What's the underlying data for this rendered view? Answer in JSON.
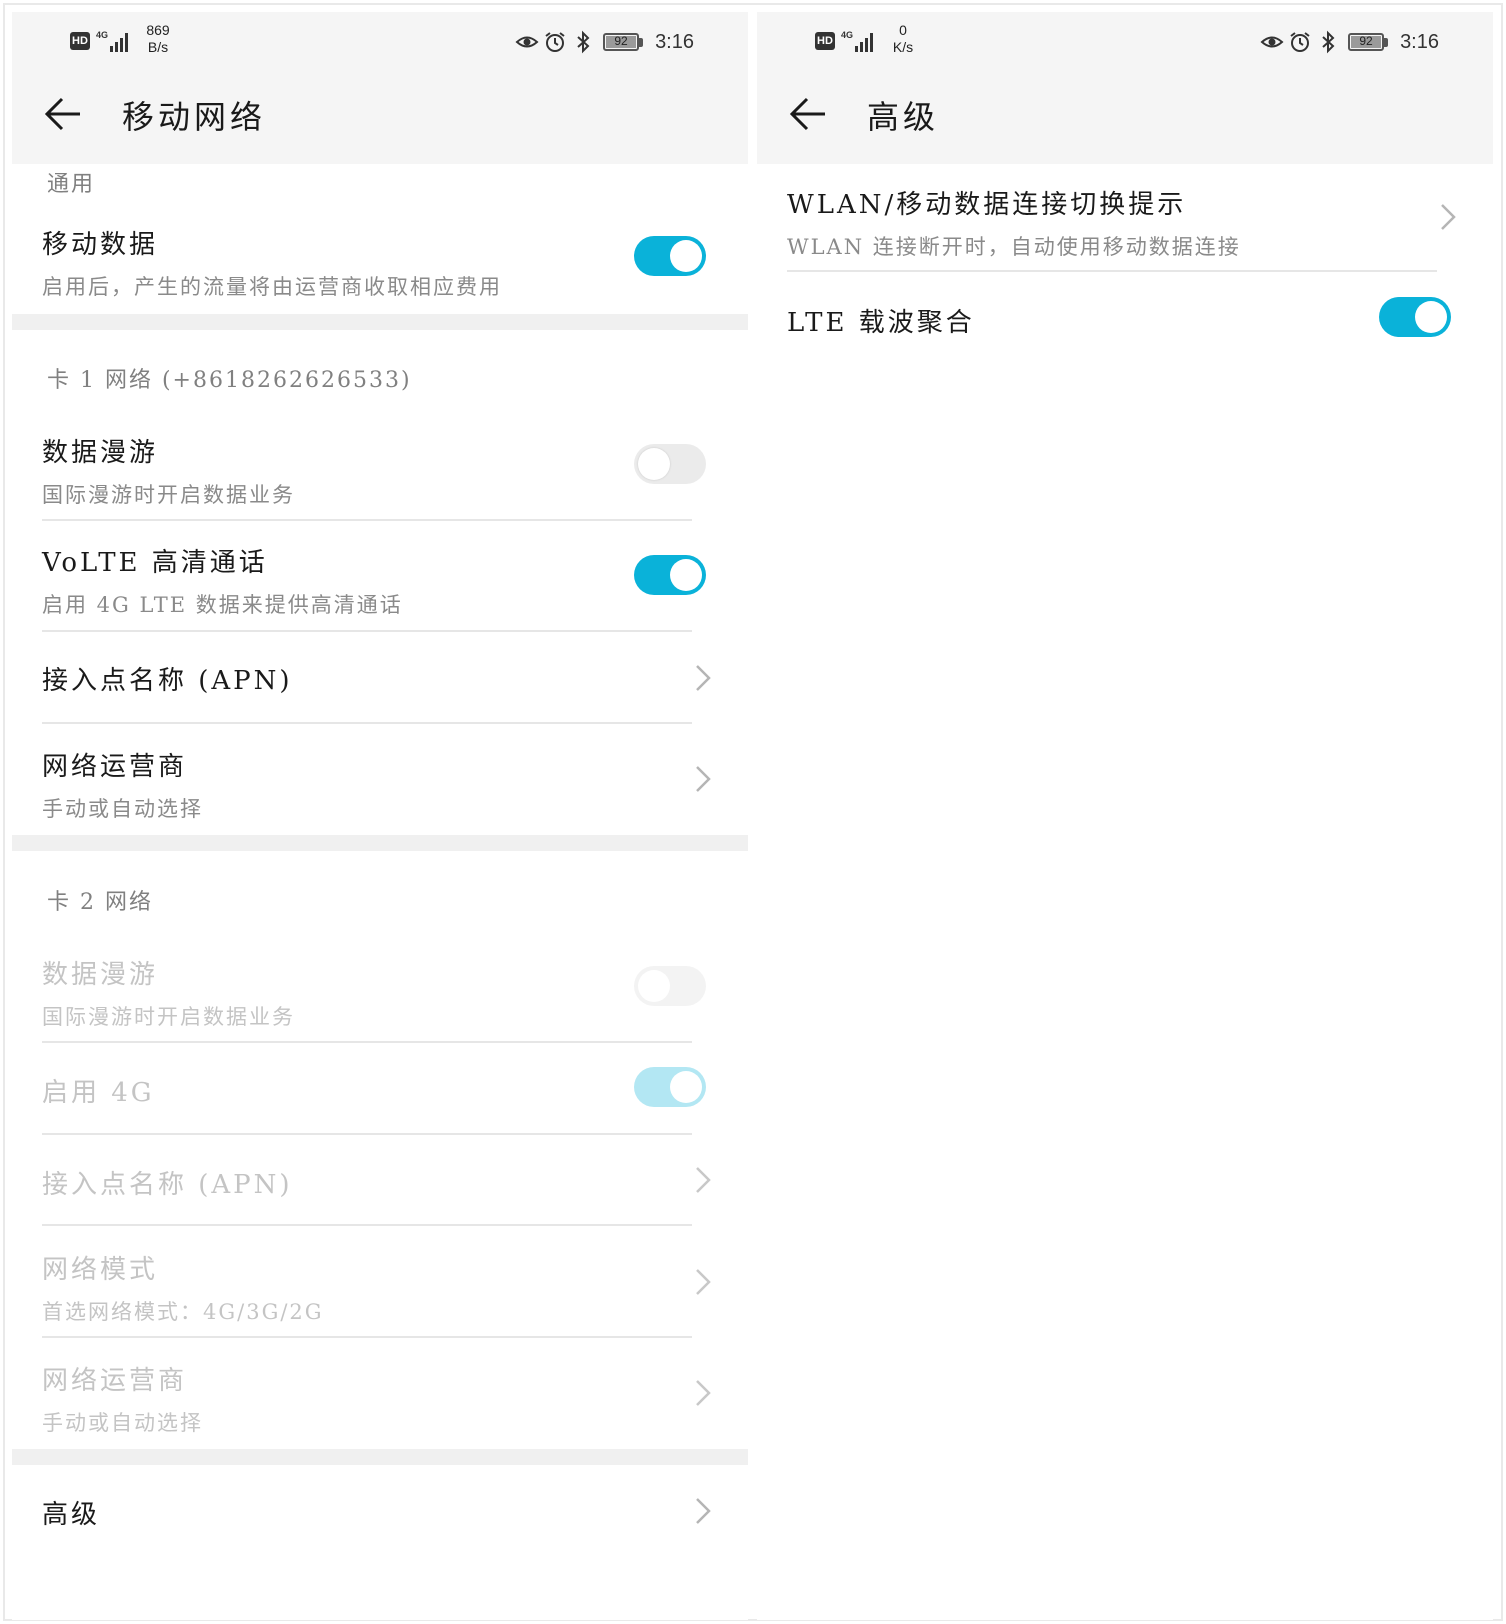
{
  "left": {
    "status": {
      "hd": "HD",
      "signal": "4G",
      "speed_value": "869",
      "speed_unit": "B/s",
      "battery": "92",
      "time": "3:16"
    },
    "header": {
      "title": "移动网络"
    },
    "general": {
      "section": "通用",
      "mobile_data": {
        "title": "移动数据",
        "subtitle": "启用后，产生的流量将由运营商收取相应费用",
        "toggle": "on"
      }
    },
    "sim1": {
      "section": "卡 1 网络 (+8618262626533)",
      "roaming": {
        "title": "数据漫游",
        "subtitle": "国际漫游时开启数据业务",
        "toggle": "off"
      },
      "volte": {
        "title": "VoLTE 高清通话",
        "subtitle": "启用 4G LTE 数据来提供高清通话",
        "toggle": "on"
      },
      "apn": {
        "title": "接入点名称 (APN)"
      },
      "carrier": {
        "title": "网络运营商",
        "subtitle": "手动或自动选择"
      }
    },
    "sim2": {
      "section": "卡 2 网络",
      "roaming": {
        "title": "数据漫游",
        "subtitle": "国际漫游时开启数据业务",
        "toggle": "off-disabled"
      },
      "enable4g": {
        "title": "启用 4G",
        "toggle": "on-disabled"
      },
      "apn": {
        "title": "接入点名称 (APN)"
      },
      "mode": {
        "title": "网络模式",
        "subtitle": "首选网络模式：4G/3G/2G"
      },
      "carrier": {
        "title": "网络运营商",
        "subtitle": "手动或自动选择"
      }
    },
    "advanced": {
      "title": "高级"
    }
  },
  "right": {
    "status": {
      "hd": "HD",
      "signal": "4G",
      "speed_value": "0",
      "speed_unit": "K/s",
      "battery": "92",
      "time": "3:16"
    },
    "header": {
      "title": "高级"
    },
    "wlan_switch": {
      "title": "WLAN/移动数据连接切换提示",
      "subtitle": "WLAN 连接断开时，自动使用移动数据连接"
    },
    "lte_ca": {
      "title": "LTE 载波聚合",
      "toggle": "on"
    }
  },
  "colors": {
    "accent": "#0ab2d9",
    "accent_disabled": "#b3e7f3",
    "header_bg": "#f5f5f5",
    "section_gap": "#f0f0f0"
  }
}
